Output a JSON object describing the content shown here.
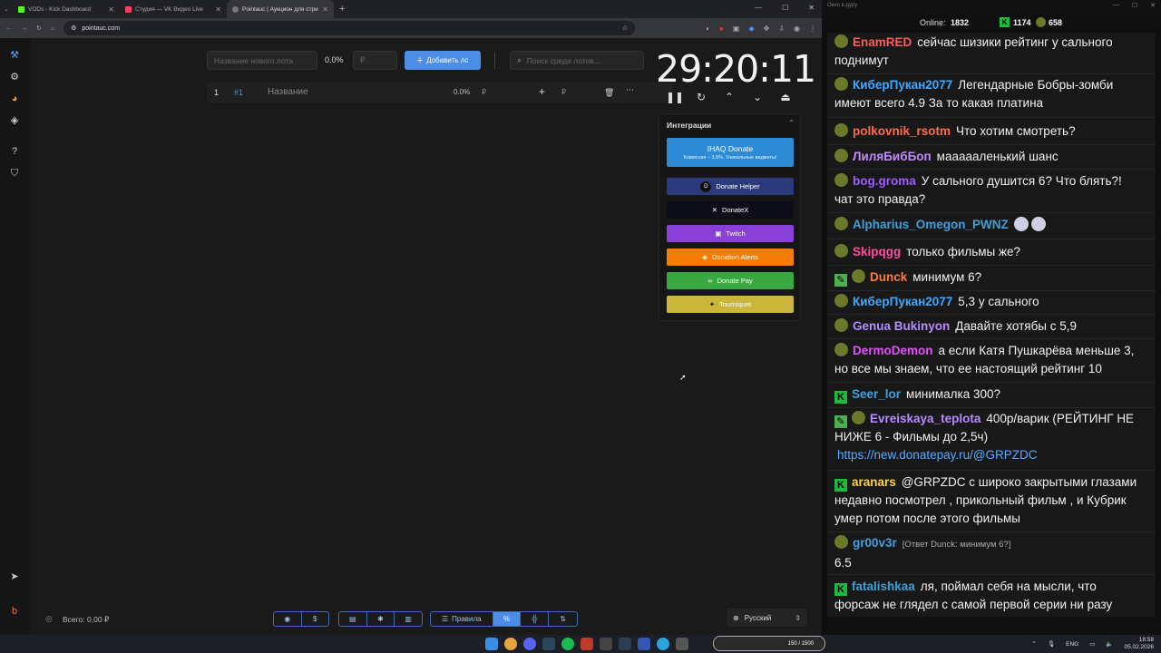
{
  "browser": {
    "tabs": [
      {
        "title": "VODs - Kick Dashboard",
        "color": "#53fc18"
      },
      {
        "title": "Студия — VK Видео Live",
        "color": "#ff3d5c"
      },
      {
        "title": "Pointauc | Аукцион для стрима",
        "color": "#777777"
      }
    ],
    "url": "pointauc.com"
  },
  "auction": {
    "new_lot_placeholder": "Название нового лота",
    "percent": "0.0%",
    "amount_placeholder": "₽",
    "add_button": "Добавить лот",
    "search_placeholder": "Поиск среди лотов...",
    "lot": {
      "index": "1",
      "id": "#1",
      "name": "Название",
      "percent": "0.0%",
      "currency": "₽",
      "currency2": "₽"
    },
    "timer": "29:20:11"
  },
  "integrations": {
    "title": "Интеграции",
    "ihaq": {
      "label": "IHAQ Donate",
      "sub": "Комиссия – 3,5%. Уникальные виджеты!"
    },
    "buttons": [
      {
        "label": "Donate Helper",
        "color": "#2b3a7a"
      },
      {
        "label": "DonateX",
        "color": "#0d0d1a"
      },
      {
        "label": "Twitch",
        "color": "#8b3fd9"
      },
      {
        "label": "Donation Alerts",
        "color": "#f57d07"
      },
      {
        "label": "Donate Pay",
        "color": "#3aa841"
      },
      {
        "label": "Tourniquet",
        "color": "#c9b63a"
      }
    ]
  },
  "bottom": {
    "total": "Всего: 0,00 ₽",
    "rules": "Правила",
    "language": "Русский"
  },
  "chat": {
    "window_title": "Окно в дуру",
    "online_label": "Online:",
    "online": "1832",
    "kick_count": "1174",
    "other_count": "658",
    "messages": [
      {
        "nick": "EnamRED",
        "color": "#ff5c5c",
        "text": "сейчас шизики рейтинг у сального поднимут"
      },
      {
        "nick": "КиберПукан2077",
        "color": "#3fa9ff",
        "text": "Легендарные Бобры-зомби имеют всего 4.9 За то какая платина"
      },
      {
        "nick": "polkovnik_rsotm",
        "color": "#ff6b4a",
        "text": "Что хотим смотреть?"
      },
      {
        "nick": "ЛиляБибБоп",
        "color": "#c38bff",
        "text": "маааааленький шанс"
      },
      {
        "nick": "bog.groma",
        "color": "#a05cff",
        "text": "У сального душится 6? Что блять?! чат это правда?"
      },
      {
        "nick": "Alpharius_Omegon_PWNZ",
        "color": "#3fa0d9",
        "text": ""
      },
      {
        "nick": "Skipqgg",
        "color": "#ff4fa0",
        "text": "только фильмы же?"
      },
      {
        "nick": "Dunck",
        "color": "#ff7a3d",
        "text": "минимум 6?"
      },
      {
        "nick": "КиберПукан2077",
        "color": "#3fa9ff",
        "text": "5,3 у сального"
      },
      {
        "nick": "Genua Bukinyon",
        "color": "#b48cff",
        "text": "Давайте хотябы с 5,9"
      },
      {
        "nick": "DermoDemon",
        "color": "#e44fff",
        "text": "а если Катя Пушкарёва меньше 3, но все мы знаем, что ее настоящий рейтинг 10"
      },
      {
        "nick": "Seer_lor",
        "color": "#3f9fe0",
        "text": "минималка 300?"
      },
      {
        "nick": "Evreiskaya_teplota",
        "color": "#b48cff",
        "text": "400р/варик (РЕЙТИНГ НЕ НИЖЕ 6 - Фильмы до 2,5ч)",
        "link": "https://new.donatepay.ru/@GRPZDC"
      },
      {
        "nick": "aranars",
        "color": "#ffd23f",
        "text": "@GRPZDC с широко закрытыми глазами недавно посмотрел , прикольный фильм , и Кубрик умер потом после этого фильмы"
      },
      {
        "nick": "gr00v3r",
        "color": "#3f9fe0",
        "reply": "[Ответ Dunck: минимум 6?]",
        "text": "6.5"
      },
      {
        "nick": "fatalishkaa",
        "color": "#3fa0d9",
        "text": "ля, поймал себя на мысли, что форсаж не глядел с самой первой серии ни разу"
      }
    ]
  },
  "taskbar": {
    "time": "18:58",
    "date": "05.02.2026",
    "lang": "ENG",
    "widget": "150 / 1500"
  }
}
